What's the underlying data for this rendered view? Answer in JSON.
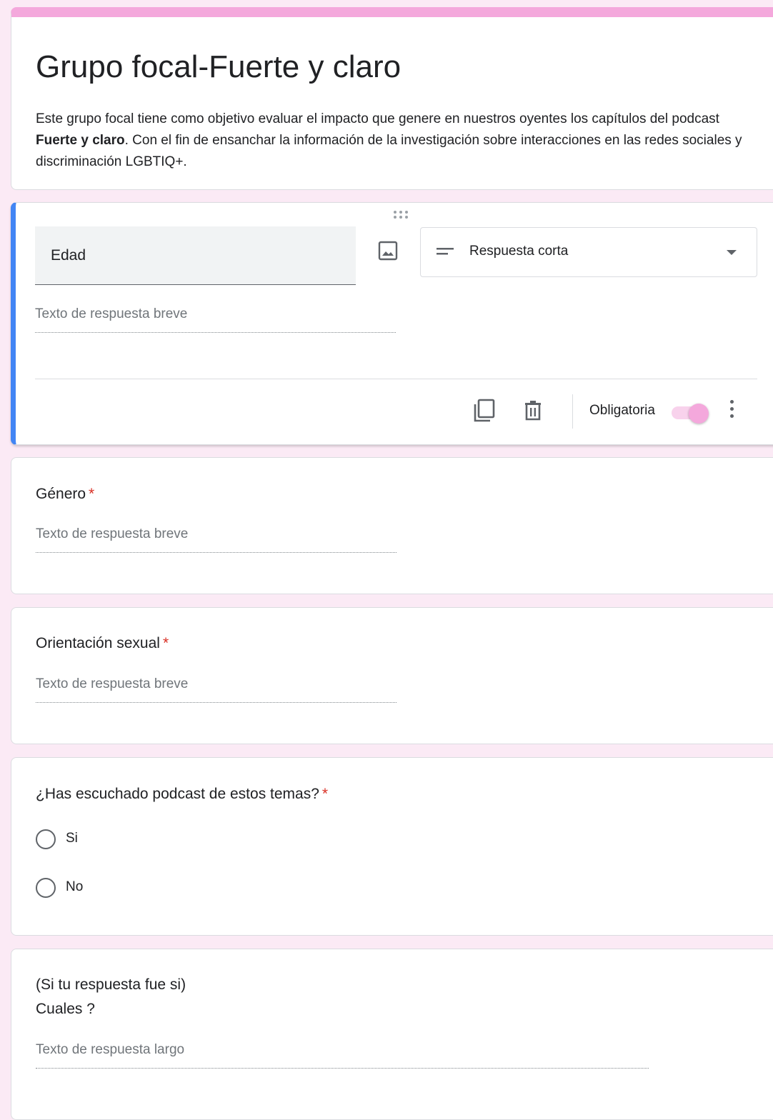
{
  "form": {
    "title": "Grupo focal-Fuerte y claro",
    "description_before": "Este grupo focal tiene como objetivo evaluar el impacto que genere en nuestros oyentes los capítulos del podcast ",
    "description_bold": "Fuerte y claro",
    "description_after": ". Con el fin de ensanchar la información de la investigación sobre interacciones en las redes sociales y discriminación LGBTIQ+.",
    "accent_color": "#f4a8dc"
  },
  "active_question": {
    "title": "Edad",
    "type_label": "Respuesta corta",
    "answer_placeholder": "Texto de respuesta breve",
    "required_label": "Obligatoria",
    "required": true,
    "focus_color": "#4285f4"
  },
  "questions": [
    {
      "title": "Género",
      "required_mark": "*",
      "answer_placeholder": "Texto de respuesta breve"
    },
    {
      "title": "Orientación sexual",
      "required_mark": "*",
      "answer_placeholder": "Texto de respuesta breve"
    },
    {
      "title": "¿Has escuchado podcast de estos temas?",
      "required_mark": "*",
      "options": [
        "Si",
        "No"
      ]
    },
    {
      "title_line1": "(Si tu respuesta fue si)",
      "title_line2": "Cuales ?",
      "answer_placeholder": "Texto de respuesta largo"
    }
  ]
}
